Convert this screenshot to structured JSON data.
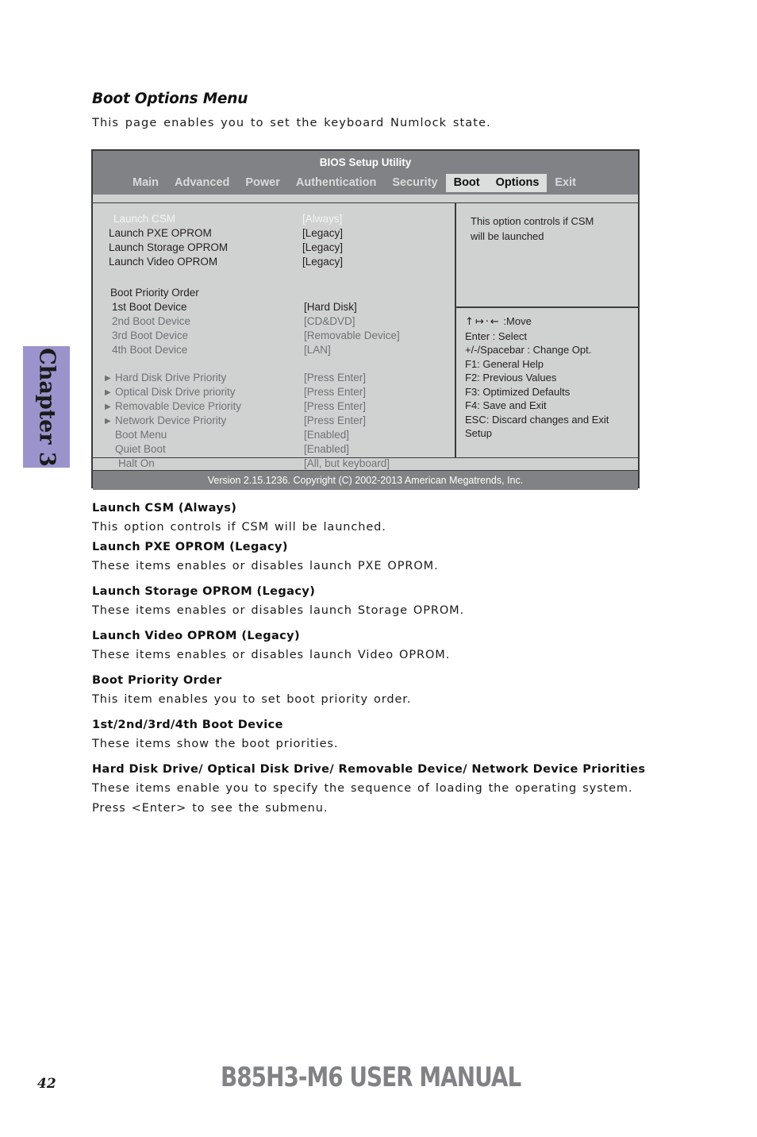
{
  "chapter_tab": {
    "label": "Chapter 3",
    "color": "#9b93cc"
  },
  "page": {
    "heading": "Boot Options Menu",
    "intro": "This page enables you to set the keyboard Numlock state."
  },
  "bios": {
    "title": "BIOS Setup Utility",
    "tabs": [
      {
        "label": "Main",
        "active": false
      },
      {
        "label": "Advanced",
        "active": false
      },
      {
        "label": "Power",
        "active": false
      },
      {
        "label": "Authentication",
        "active": false
      },
      {
        "label": "Security",
        "active": false
      },
      {
        "label": "Boot",
        "active": true
      },
      {
        "label": "Options",
        "active": true
      },
      {
        "label": "Exit",
        "active": false
      }
    ],
    "options": [
      {
        "label": "Launch CSM",
        "value": "[Always]"
      },
      {
        "label": "Launch PXE OPROM",
        "value": "[Legacy]"
      },
      {
        "label": "Launch Storage OPROM",
        "value": "[Legacy]"
      },
      {
        "label": "Launch Video OPROM",
        "value": "[Legacy]"
      },
      {
        "label": "Boot Priority Order",
        "value": ""
      },
      {
        "label": "1st Boot Device",
        "value": "[Hard Disk]"
      },
      {
        "label": "2nd Boot Device",
        "value": "[CD&DVD]"
      },
      {
        "label": "3rd Boot Device",
        "value": "[Removable Device]"
      },
      {
        "label": "4th Boot Device",
        "value": "[LAN]"
      },
      {
        "label": "Hard Disk Drive Priority",
        "value": "[Press Enter]"
      },
      {
        "label": "Optical Disk Drive priority",
        "value": "[Press Enter]"
      },
      {
        "label": "Removable Device Priority",
        "value": "[Press Enter]"
      },
      {
        "label": "Network Device Priority",
        "value": "[Press Enter]"
      },
      {
        "label": "Boot Menu",
        "value": "[Enabled]"
      },
      {
        "label": "Quiet Boot",
        "value": "[Enabled]"
      },
      {
        "label": "Halt On",
        "value": "[All, but keyboard]"
      }
    ],
    "help": {
      "line1": "This option controls if CSM",
      "line2": "will be launched"
    },
    "keys": {
      "move_glyphs": "↑↦·←",
      "move_label": ":Move",
      "lines": [
        "Enter : Select",
        "+/-/Spacebar  : Change Opt.",
        "F1: General Help",
        "F2: Previous Values",
        " F3: Optimized Defaults",
        " F4: Save and Exit",
        "ESC: Discard changes and Exit",
        " Setup"
      ]
    },
    "footer": "Version 2.15.1236. Copyright (C) 2002-2013 American Megatrends,  Inc."
  },
  "descriptions": [
    {
      "heading": "Launch CSM (Always)",
      "body": "This option controls if CSM will be launched."
    },
    {
      "heading": "Launch PXE OPROM (Legacy)",
      "body": "These items enables or disables launch PXE OPROM."
    },
    {
      "heading": "Launch Storage OPROM (Legacy)",
      "body": "These items enables or disables launch Storage OPROM."
    },
    {
      "heading": "Launch Video OPROM (Legacy)",
      "body": "These items enables or disables launch Video OPROM."
    },
    {
      "heading": "Boot Priority Order",
      "body": "This item enables you to set boot priority order."
    },
    {
      "heading": "1st/2nd/3rd/4th Boot Device",
      "body": "These items show the boot priorities."
    },
    {
      "heading": "Hard Disk Drive/ Optical Disk Drive/ Removable Device/ Network  Device Priorities",
      "body": "These items enable you to specify the sequence of loading the operating system.",
      "body2": "Press <Enter> to see the submenu."
    }
  ],
  "footer": {
    "page_number": "42",
    "manual_title": "B85H3-M6 USER MANUAL"
  }
}
